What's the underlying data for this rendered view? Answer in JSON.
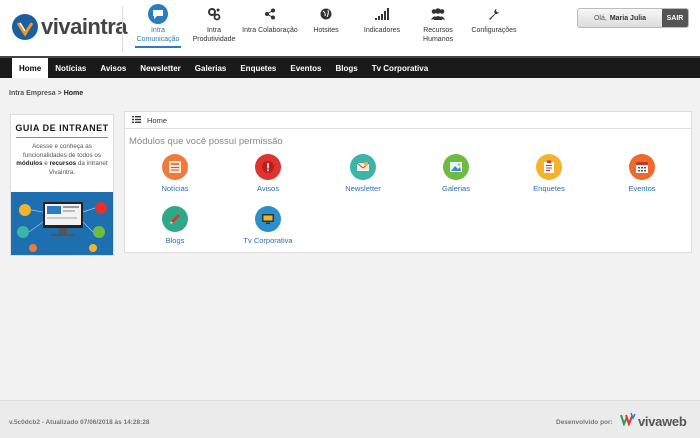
{
  "header": {
    "logo_text": "vivaintra",
    "topnav": [
      {
        "label": "Intra Comunicação",
        "icon": "chat-bubble-icon",
        "active": true
      },
      {
        "label": "Intra Produtividade",
        "icon": "gears-icon",
        "active": false
      },
      {
        "label": "Intra Colaboração",
        "icon": "share-icon",
        "active": false
      },
      {
        "label": "Hotsites",
        "icon": "globe-icon",
        "active": false
      },
      {
        "label": "Indicadores",
        "icon": "bar-chart-icon",
        "active": false
      },
      {
        "label": "Recursos Humanos",
        "icon": "people-icon",
        "active": false
      },
      {
        "label": "Configurações",
        "icon": "wrench-icon",
        "active": false
      }
    ],
    "user": {
      "greeting": "Olá,",
      "name": "Maria Julia",
      "logout_label": "SAIR"
    }
  },
  "mainnav": [
    {
      "label": "Home",
      "active": true
    },
    {
      "label": "Notícias"
    },
    {
      "label": "Avisos"
    },
    {
      "label": "Newsletter"
    },
    {
      "label": "Galerias"
    },
    {
      "label": "Enquetes"
    },
    {
      "label": "Eventos"
    },
    {
      "label": "Blogs"
    },
    {
      "label": "Tv Corporativa"
    }
  ],
  "breadcrumb": {
    "parent": "Intra Empresa",
    "separator": ">",
    "current": "Home"
  },
  "promo": {
    "title": "GUIA DE INTRANET",
    "text_1": "Acesse e conheça as funcionalidades de todos os",
    "text_bold_1": "módulos",
    "text_2": "e",
    "text_bold_2": "recursos",
    "text_3": "da intranet Vivaintra."
  },
  "panel": {
    "heading": "Home",
    "subheading": "Módulos que você possui permissão",
    "modules": [
      {
        "label": "Notícias",
        "icon": "newspaper-icon",
        "color": "#f07a3a"
      },
      {
        "label": "Avisos",
        "icon": "alert-icon",
        "color": "#e0332d"
      },
      {
        "label": "Newsletter",
        "icon": "mail-icon",
        "color": "#3bb5a7"
      },
      {
        "label": "Galerias",
        "icon": "image-icon",
        "color": "#6dbb3f"
      },
      {
        "label": "Enquetes",
        "icon": "clipboard-icon",
        "color": "#f3b42c"
      },
      {
        "label": "Eventos",
        "icon": "calendar-icon",
        "color": "#ef6a2a"
      },
      {
        "label": "Blogs",
        "icon": "pencil-icon",
        "color": "#2fa88a"
      },
      {
        "label": "Tv Corporativa",
        "icon": "tv-icon",
        "color": "#2b8fc9"
      }
    ]
  },
  "footer": {
    "version": "v.5c0dcb2 - Atualizado 07/06/2018 às 14:28:28",
    "developed_by": "Desenvolvido por:",
    "brand": "vivaweb"
  }
}
